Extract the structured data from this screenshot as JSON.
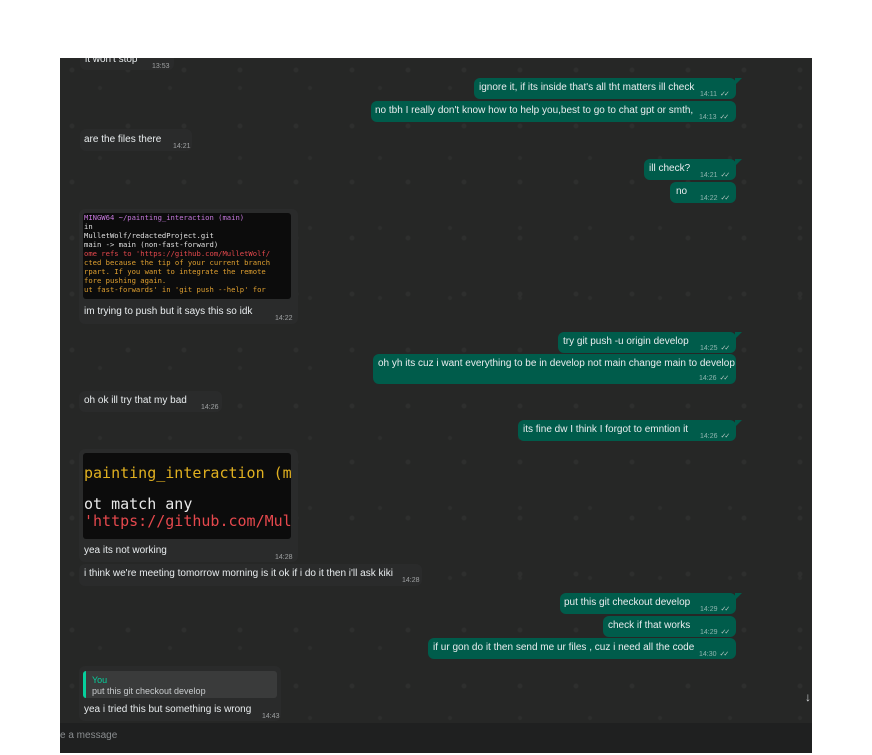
{
  "messages": [
    {
      "text": "it won't stop",
      "time": "13:53"
    },
    {
      "text": "ignore it, if its inside that's all tht matters ill check",
      "time": "14:11"
    },
    {
      "text": "no tbh I really don't know how to help you,best to go to chat gpt or smth,",
      "time": "14:13"
    },
    {
      "text": "are the files there",
      "time": "14:21"
    },
    {
      "text": "ill check?",
      "time": "14:21"
    },
    {
      "text": "no",
      "time": "14:22"
    },
    {
      "text": "im trying to push but it says this so idk",
      "time": "14:22",
      "terminal": [
        "MINGW64 ~/painting_interaction (main)",
        "in",
        "MulletWolf/redactedProject.git",
        "main -> main (non-fast-forward)",
        "ome refs to 'https://github.com/MulletWolf/",
        "cted because the tip of your current branch",
        "rpart. If you want to integrate the remote",
        "fore pushing again.",
        "ut fast-forwards' in 'git push --help' for"
      ]
    },
    {
      "text": "try git push -u origin develop",
      "time": "14:25"
    },
    {
      "text": "oh yh its cuz i want everything to be in develop not main change main to develop",
      "time": "14:26"
    },
    {
      "text": "oh ok ill try that my bad",
      "time": "14:26"
    },
    {
      "text": "its fine dw I think I forgot to emntion it",
      "time": "14:26"
    },
    {
      "text": "yea its not working",
      "time": "14:28",
      "terminal": [
        "painting_interaction (mai",
        "ot match any",
        "'https://github.com/Mul"
      ]
    },
    {
      "text": "i think we're meeting tomorrow morning is it ok if i do it then i'll ask kiki",
      "time": "14:28"
    },
    {
      "text": "put this git checkout develop",
      "time": "14:29"
    },
    {
      "text": "check if that works",
      "time": "14:29"
    },
    {
      "text": "if ur gon do it then send me  ur files , cuz i need all the code",
      "time": "14:30"
    },
    {
      "text": "yea i tried this but something is wrong",
      "time": "14:43",
      "quote_author": "You",
      "quote_text": "put this git checkout develop"
    }
  ],
  "composer": {
    "placeholder": "e a message"
  },
  "icons": {
    "read": "double-check-icon",
    "scroll": "arrow-down-icon"
  },
  "colors": {
    "outgoing": "#005c4b",
    "incoming": "#2a2b2b",
    "background": "#262726",
    "quote_bar": "#06cf9c"
  }
}
